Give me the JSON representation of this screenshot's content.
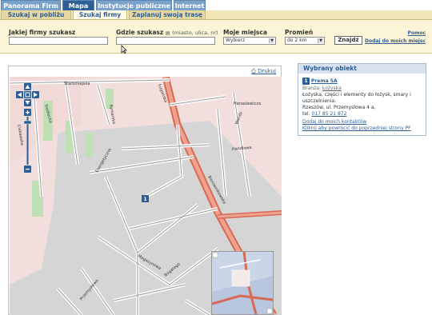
{
  "top_tabs": [
    {
      "label": "Panorama Firm"
    },
    {
      "label": "Mapa"
    },
    {
      "label": "Instytucje publiczne"
    },
    {
      "label": "Internet"
    }
  ],
  "sub_tabs": [
    {
      "label": "Szukaj w pobliżu"
    },
    {
      "label": "Szukaj firmy"
    },
    {
      "label": "Zaplanuj swoją trasę"
    }
  ],
  "search": {
    "company_label": "Jakiej firmy szukasz",
    "company_value": "",
    "where_label": "Gdzie szukasz",
    "where_hint": "(miasto, ulica, nr)",
    "where_value": "",
    "places_label": "Moje miejsca",
    "places_selected": "Wybierz",
    "radius_label": "Promień",
    "radius_selected": "do 2 km",
    "find_button": "Znajdź",
    "help_link": "Pomoc",
    "add_link": "Dodaj do moich miejsc"
  },
  "map": {
    "print_link": "Drukuj",
    "streets": [
      "Staromiejska",
      "Hanasiewicza",
      "Handlowa",
      "Siedlecka",
      "Ciekawska",
      "Rymarska",
      "Energetyczna",
      "Ługańska",
      "Wandy",
      "Bierzwnikowska",
      "Bohaterów",
      "Przemysłowa",
      "Narwikowa",
      "Bogatego",
      "Zębowicka",
      "Przemysłowa",
      "Wincenty",
      "Magazynowa",
      "Warszawska",
      "Wolna"
    ],
    "marker_label": "1"
  },
  "panel": {
    "title": "Wybrany obiekt",
    "number": "1",
    "company_name": "Prema SA",
    "branch_label": "Branża:",
    "branch_value": "Łożyska",
    "description": "Łożyska, części i elementy do łożysk, smary i uszczelnienia.",
    "address": "Rzeszów, ul. Przemysłowa 4 a,",
    "phone_label": "tel.",
    "phone": "017 85 21 872",
    "add_contacts": "Dodaj do moich kontaktów",
    "back_link": "Kliknij aby powrócić do poprzedniej strony PF"
  }
}
